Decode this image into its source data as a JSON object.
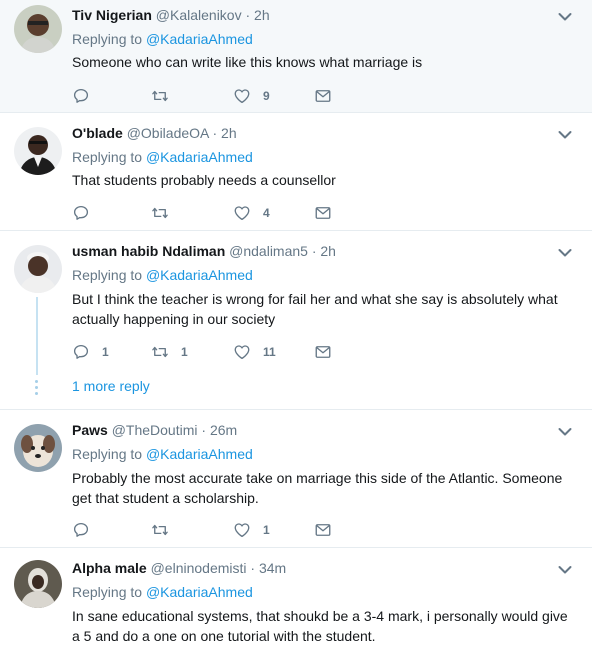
{
  "tweets": [
    {
      "name": "Tiv Nigerian",
      "handle": "@Kalalenikov",
      "time": "· 2h",
      "replying_prefix": "Replying to",
      "replying_to": "@KadariaAhmed",
      "text": "Someone who can write like this knows what marriage is",
      "replies": "",
      "retweets": "",
      "likes": "9"
    },
    {
      "name": "O'blade",
      "handle": "@ObiladeOA",
      "time": "· 2h",
      "replying_prefix": "Replying to",
      "replying_to": "@KadariaAhmed",
      "text": "That students probably needs a counsellor",
      "replies": "",
      "retweets": "",
      "likes": "4"
    },
    {
      "name": "usman habib Ndaliman",
      "handle": "@ndaliman5",
      "time": "· 2h",
      "replying_prefix": "Replying to",
      "replying_to": "@KadariaAhmed",
      "text": "But I think the teacher is wrong for fail  her and what she say is absolutely what actually happening in our society",
      "replies": "1",
      "retweets": "1",
      "likes": "11",
      "more_replies": "1 more reply"
    },
    {
      "name": "Paws",
      "handle": "@TheDoutimi",
      "time": "· 26m",
      "replying_prefix": "Replying to",
      "replying_to": "@KadariaAhmed",
      "text": "Probably the most accurate take on marriage this side of the Atlantic. Someone get that student a scholarship.",
      "replies": "",
      "retweets": "",
      "likes": "1"
    },
    {
      "name": "Alpha male",
      "handle": "@elninodemisti",
      "time": "· 34m",
      "replying_prefix": "Replying to",
      "replying_to": "@KadariaAhmed",
      "text": "In sane educational systems, that shoukd be a 3-4 mark, i personally would give a 5 and do a one on one tutorial with the student."
    }
  ],
  "colors": {
    "link": "#1b95e0",
    "muted": "#657786",
    "highlight_bg": "#f5f8fa",
    "thread_line": "#c6e2f2"
  },
  "icons": [
    "reply-icon",
    "retweet-icon",
    "heart-icon",
    "direct-message-icon",
    "chevron-down-icon"
  ]
}
